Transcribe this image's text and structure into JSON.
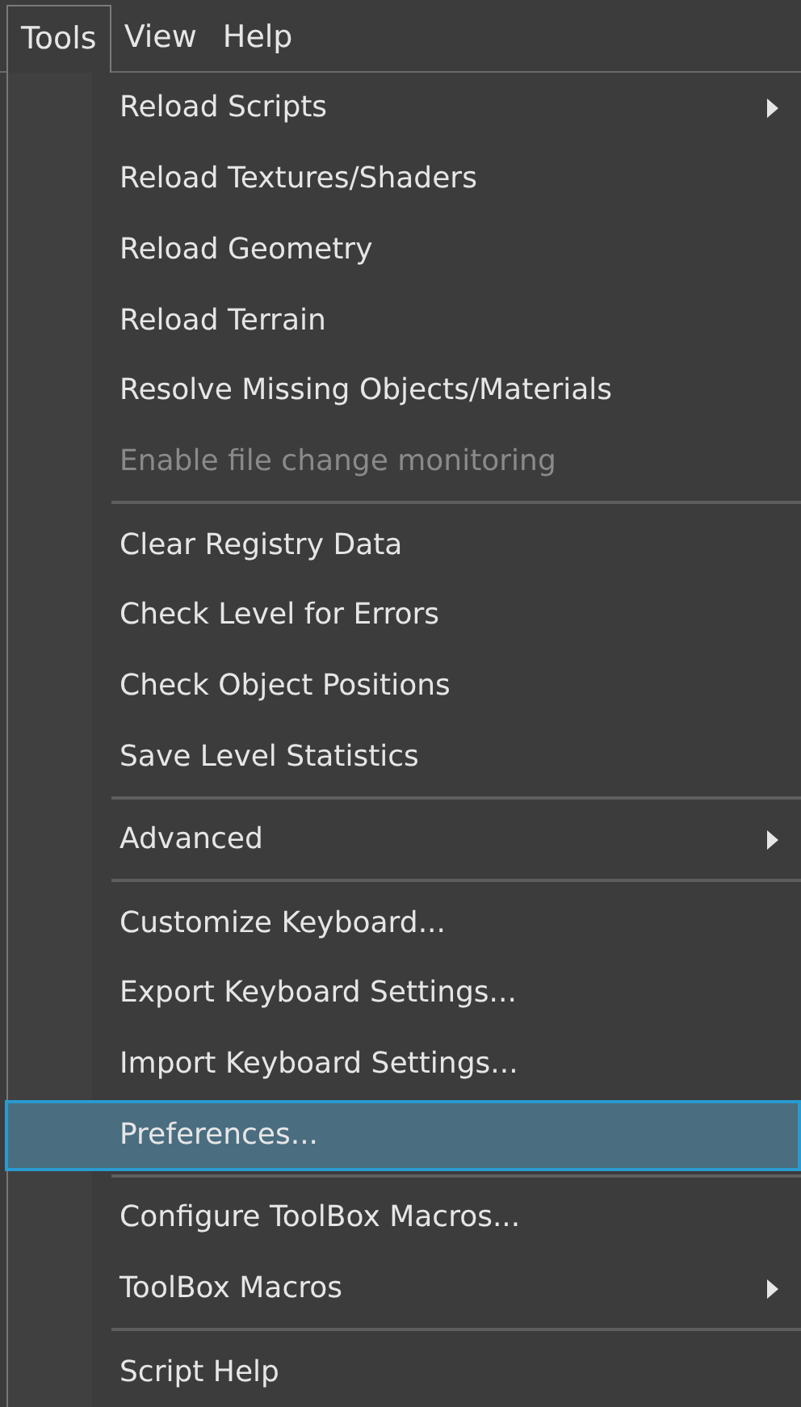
{
  "menubar": [
    {
      "label": "Tools",
      "selected": true
    },
    {
      "label": "View",
      "selected": false
    },
    {
      "label": "Help",
      "selected": false
    }
  ],
  "menu": {
    "items": [
      {
        "kind": "item",
        "label": "Reload Scripts",
        "disabled": false,
        "selected": false,
        "submenu": true
      },
      {
        "kind": "item",
        "label": "Reload Textures/Shaders",
        "disabled": false,
        "selected": false,
        "submenu": false
      },
      {
        "kind": "item",
        "label": "Reload Geometry",
        "disabled": false,
        "selected": false,
        "submenu": false
      },
      {
        "kind": "item",
        "label": "Reload Terrain",
        "disabled": false,
        "selected": false,
        "submenu": false
      },
      {
        "kind": "item",
        "label": "Resolve Missing Objects/Materials",
        "disabled": false,
        "selected": false,
        "submenu": false
      },
      {
        "kind": "item",
        "label": "Enable file change monitoring",
        "disabled": true,
        "selected": false,
        "submenu": false
      },
      {
        "kind": "separator"
      },
      {
        "kind": "item",
        "label": "Clear Registry Data",
        "disabled": false,
        "selected": false,
        "submenu": false
      },
      {
        "kind": "item",
        "label": "Check Level for Errors",
        "disabled": false,
        "selected": false,
        "submenu": false
      },
      {
        "kind": "item",
        "label": "Check Object Positions",
        "disabled": false,
        "selected": false,
        "submenu": false
      },
      {
        "kind": "item",
        "label": "Save Level Statistics",
        "disabled": false,
        "selected": false,
        "submenu": false
      },
      {
        "kind": "separator"
      },
      {
        "kind": "item",
        "label": "Advanced",
        "disabled": false,
        "selected": false,
        "submenu": true
      },
      {
        "kind": "separator"
      },
      {
        "kind": "item",
        "label": "Customize Keyboard...",
        "disabled": false,
        "selected": false,
        "submenu": false
      },
      {
        "kind": "item",
        "label": "Export Keyboard Settings...",
        "disabled": false,
        "selected": false,
        "submenu": false
      },
      {
        "kind": "item",
        "label": "Import Keyboard Settings...",
        "disabled": false,
        "selected": false,
        "submenu": false
      },
      {
        "kind": "item",
        "label": "Preferences...",
        "disabled": false,
        "selected": true,
        "submenu": false
      },
      {
        "kind": "separator"
      },
      {
        "kind": "item",
        "label": "Configure ToolBox Macros...",
        "disabled": false,
        "selected": false,
        "submenu": false
      },
      {
        "kind": "item",
        "label": "ToolBox Macros",
        "disabled": false,
        "selected": false,
        "submenu": true
      },
      {
        "kind": "separator"
      },
      {
        "kind": "item",
        "label": "Script Help",
        "disabled": false,
        "selected": false,
        "submenu": false
      }
    ]
  }
}
